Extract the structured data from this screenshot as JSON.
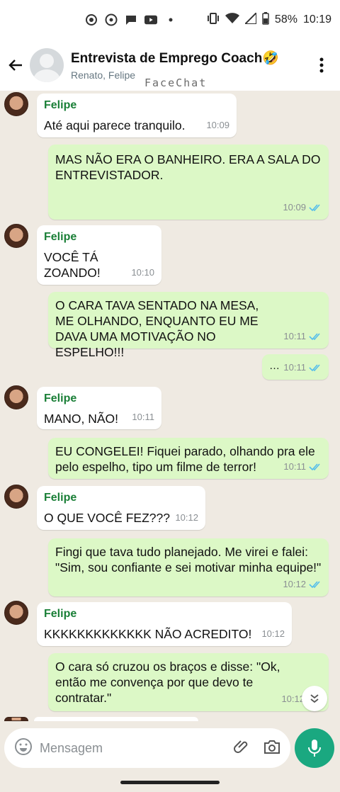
{
  "status_bar": {
    "battery": "58%",
    "time": "10:19"
  },
  "header": {
    "title": "Entrevista de Emprego Coach🤣",
    "subtitle": "Renato, Felipe",
    "watermark": "FaceChat"
  },
  "messages": [
    {
      "type": "in",
      "sender": "Felipe",
      "text": "Até aqui parece tranquilo.",
      "time": "10:09"
    },
    {
      "type": "out",
      "text": "MAS NÃO ERA O BANHEIRO. ERA A SALA DO ENTREVISTADOR.",
      "time": "10:09"
    },
    {
      "type": "in",
      "sender": "Felipe",
      "text": "VOCÊ TÁ ZOANDO!",
      "time": "10:10"
    },
    {
      "type": "out",
      "text": "O CARA TAVA SENTADO NA MESA, ME OLHANDO, ENQUANTO EU ME DAVA UMA MOTIVAÇÃO NO ESPELHO!!!",
      "time": "10:11"
    },
    {
      "type": "out",
      "text": "…",
      "time": "10:11"
    },
    {
      "type": "in",
      "sender": "Felipe",
      "text": "MANO, NÃO!",
      "time": "10:11"
    },
    {
      "type": "out",
      "text": "EU CONGELEI! Fiquei parado, olhando pra ele pelo espelho, tipo um filme de terror!",
      "time": "10:11"
    },
    {
      "type": "in",
      "sender": "Felipe",
      "text": "O QUE VOCÊ FEZ???",
      "time": "10:12"
    },
    {
      "type": "out",
      "text": "Fingi que tava tudo planejado. Me virei e falei: \"Sim, sou confiante e sei motivar minha equipe!\"",
      "time": "10:12"
    },
    {
      "type": "in",
      "sender": "Felipe",
      "text": "KKKKKKKKKKKKK NÃO ACREDITO!",
      "time": "10:12"
    },
    {
      "type": "out",
      "text": "O cara só cruzou os braços e disse: \"Ok, então me convença por que devo te contratar.\"",
      "time": "10:12"
    }
  ],
  "composer": {
    "placeholder": "Mensagem"
  },
  "colors": {
    "accent": "#1aa880",
    "outgoing": "#dcf8c6",
    "sender": "#1a7f37",
    "read_ticks": "#53bdeb"
  },
  "icons": [
    "back-arrow-icon",
    "more-vert-icon",
    "emoji-icon",
    "attach-icon",
    "camera-icon",
    "mic-icon",
    "chevron-down-icon",
    "double-check-icon"
  ]
}
